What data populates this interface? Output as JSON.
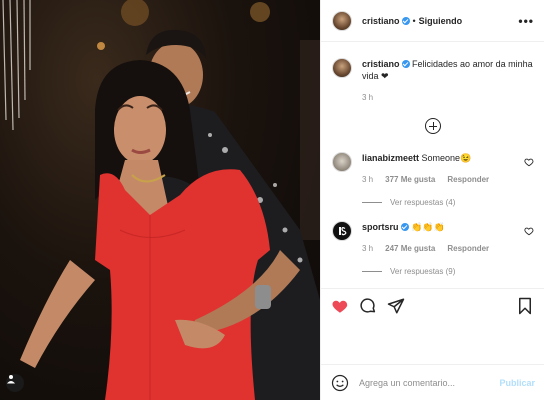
{
  "post": {
    "username": "cristiano",
    "dot": "•",
    "follow_label": "Siguiendo",
    "more_label": "•••"
  },
  "caption": {
    "username": "cristiano",
    "text": "Felicidades ao amor da minha vida ❤",
    "time": "3 h"
  },
  "comments": [
    {
      "username": "lianabizmeett",
      "text": "Someone😉",
      "time": "3 h",
      "likes": "377 Me gusta",
      "reply_label": "Responder",
      "view_replies": "Ver respuestas (4)",
      "verified": false
    },
    {
      "username": "sportsru",
      "text": "👏👏👏",
      "time": "3 h",
      "likes": "247 Me gusta",
      "reply_label": "Responder",
      "view_replies": "Ver respuestas (9)",
      "verified": true
    }
  ],
  "composer": {
    "placeholder": "Agrega un comentario...",
    "publish_label": "Publicar"
  },
  "icons": {
    "like": "heart-icon",
    "comment": "comment-icon",
    "share": "share-icon",
    "save": "bookmark-icon",
    "emoji": "emoji-icon",
    "tag": "user-tag-icon",
    "more_comments": "plus-circle-icon"
  },
  "colors": {
    "liked_heart": "#ed4956",
    "verified": "#3897f0",
    "publish_disabled": "#b2dffc",
    "dress": "#e0322f"
  }
}
